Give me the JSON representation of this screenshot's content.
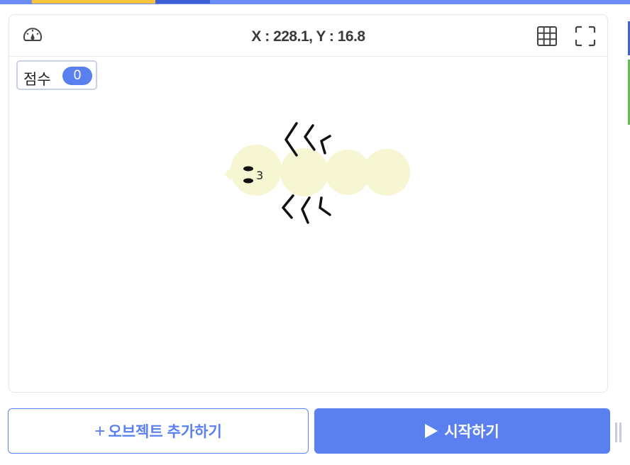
{
  "stage": {
    "coordinates": "X : 228.1, Y : 16.8",
    "speed_icon": "speedometer-icon",
    "grid_icon": "grid-icon",
    "fullscreen_icon": "fullscreen-icon"
  },
  "score": {
    "label": "점수",
    "value": "0"
  },
  "sprite": {
    "name": "caterpillar",
    "face_text": "3",
    "body_color": "#f6f6d2"
  },
  "buttons": {
    "add_object_plus": "+",
    "add_object_label": "오브젝트 추가하기",
    "start_label": "시작하기",
    "start_icon": "play-icon"
  },
  "colors": {
    "accent": "#5a80f0",
    "tab_yellow": "#f9c440",
    "tab_blue": "#3f5fd6",
    "side_green": "#5fbf4a"
  }
}
